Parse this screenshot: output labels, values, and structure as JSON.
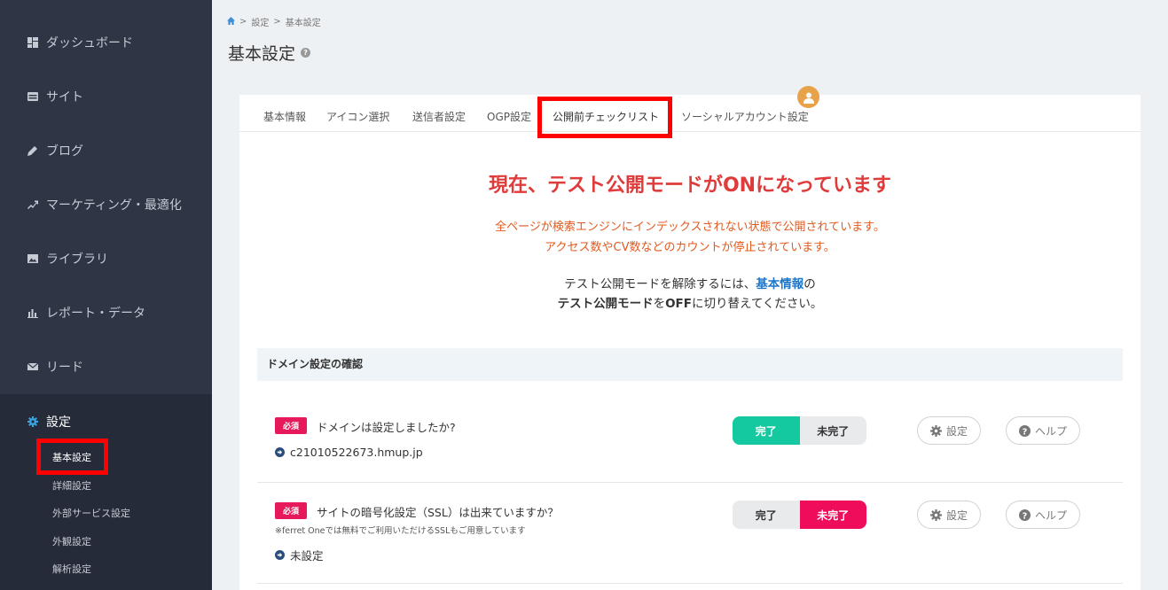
{
  "sidebar": {
    "items": [
      {
        "label": "ダッシュボード",
        "icon": "dashboard-icon"
      },
      {
        "label": "サイト",
        "icon": "site-icon"
      },
      {
        "label": "ブログ",
        "icon": "pencil-icon"
      },
      {
        "label": "マーケティング・最適化",
        "icon": "trend-icon"
      },
      {
        "label": "ライブラリ",
        "icon": "image-icon"
      },
      {
        "label": "レポート・データ",
        "icon": "bar-chart-icon"
      },
      {
        "label": "リード",
        "icon": "mail-icon"
      },
      {
        "label": "設定",
        "icon": "gear-icon"
      }
    ],
    "sub_items": [
      "基本設定",
      "詳細設定",
      "外部サービス設定",
      "外観設定",
      "解析設定"
    ]
  },
  "breadcrumb": {
    "sep": ">",
    "items": [
      "設定",
      "基本設定"
    ]
  },
  "page": {
    "title": "基本設定"
  },
  "tabs": [
    "基本情報",
    "アイコン選択",
    "送信者設定",
    "OGP設定",
    "公開前チェックリスト",
    "ソーシャルアカウント設定"
  ],
  "warning": {
    "title": "現在、テスト公開モードがONになっています",
    "line1": "全ページが検索エンジンにインデックスされない状態で公開されています。",
    "line2": "アクセス数やCV数などのカウントが停止されています。",
    "info_a": "テスト公開モードを解除するには、",
    "info_link": "基本情報",
    "info_b": "の",
    "info_c": "テスト公開モード",
    "info_d": "を",
    "info_e": "OFF",
    "info_f": "に切り替えてください。"
  },
  "section": {
    "title": "ドメイン設定の確認"
  },
  "checks": [
    {
      "badge": "必須",
      "question": "ドメインは設定しましたか?",
      "note": "",
      "detail": "c21010522673.hmup.jp",
      "status": "done",
      "done_label": "完了",
      "notdone_label": "未完了",
      "settings_label": "設定",
      "help_label": "ヘルプ"
    },
    {
      "badge": "必須",
      "question": "サイトの暗号化設定（SSL）は出来ていますか？",
      "note": "※ferret Oneでは無料でご利用いただけるSSLもご用意しています",
      "detail": "未設定",
      "status": "notdone",
      "done_label": "完了",
      "notdone_label": "未完了",
      "settings_label": "設定",
      "help_label": "ヘルプ"
    }
  ],
  "colors": {
    "sidebar": "#2e3545",
    "accent_done": "#14c8a0",
    "accent_notdone": "#ee0c5b",
    "warning": "#e03b3b",
    "highlight": "#ff0000"
  }
}
